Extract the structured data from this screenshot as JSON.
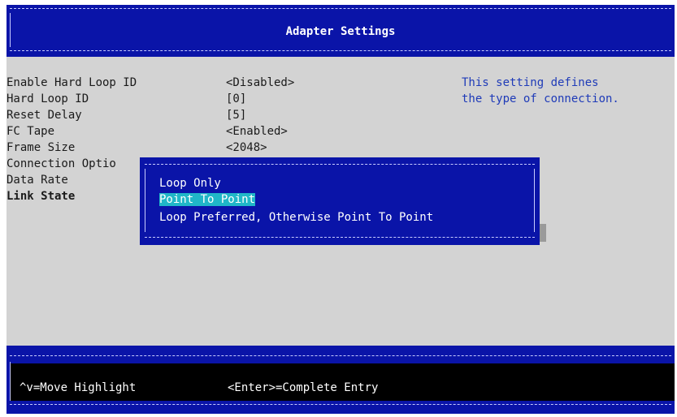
{
  "header": {
    "title": "Adapter Settings"
  },
  "settings": [
    {
      "label": "Enable Hard Loop ID",
      "value": "<Disabled>"
    },
    {
      "label": "Hard Loop ID",
      "value": "[0]"
    },
    {
      "label": "Reset Delay",
      "value": "[5]"
    },
    {
      "label": "FC Tape",
      "value": "<Enabled>"
    },
    {
      "label": "Frame Size",
      "value": "<2048>"
    },
    {
      "label": "Connection Optio",
      "value": ""
    },
    {
      "label": "Data Rate",
      "value": ""
    },
    {
      "label": "Link State",
      "value": ""
    }
  ],
  "help": {
    "line1": "This setting defines",
    "line2": "the type of connection."
  },
  "popup": {
    "options": [
      "Loop Only",
      "Point To Point",
      "Loop Preferred, Otherwise Point To Point"
    ],
    "selected_index": 1
  },
  "footer": {
    "move_hint": "^v=Move Highlight",
    "enter_hint": "<Enter>=Complete Entry"
  },
  "colors": {
    "bar_blue": "#0a14a8",
    "highlight": "#20b6c8",
    "help_text": "#1f3bb8"
  }
}
